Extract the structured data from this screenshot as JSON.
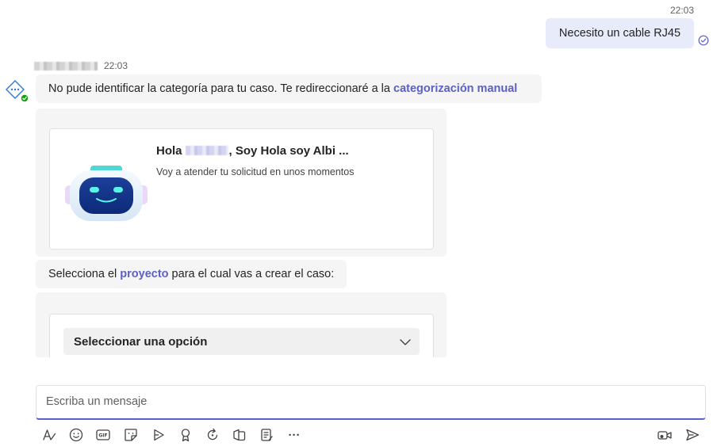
{
  "outgoing": {
    "time": "22:03",
    "text": "Necesito un cable RJ45"
  },
  "bot": {
    "time": "22:03",
    "message1": {
      "text": "No pude identificar la categoría para tu caso. Te redireccionaré a la ",
      "link": "categorización manual"
    },
    "card": {
      "title_prefix": "Hola",
      "title_suffix": ", Soy Hola soy Albi ...",
      "subtitle": "Voy a atender tu solicitud en unos momentos"
    },
    "message2": {
      "prefix": "Selecciona el ",
      "link": "proyecto",
      "suffix": " para el cual vas a crear el caso:"
    },
    "select": {
      "value": "Seleccionar una opción"
    }
  },
  "compose": {
    "placeholder": "Escriba un mensaje"
  },
  "toolbar": {
    "more_label": "···"
  },
  "colors": {
    "accent": "#5b5fc7",
    "outgoing_bubble": "#e8ebfa",
    "incoming_bubble": "#f5f5f5"
  }
}
